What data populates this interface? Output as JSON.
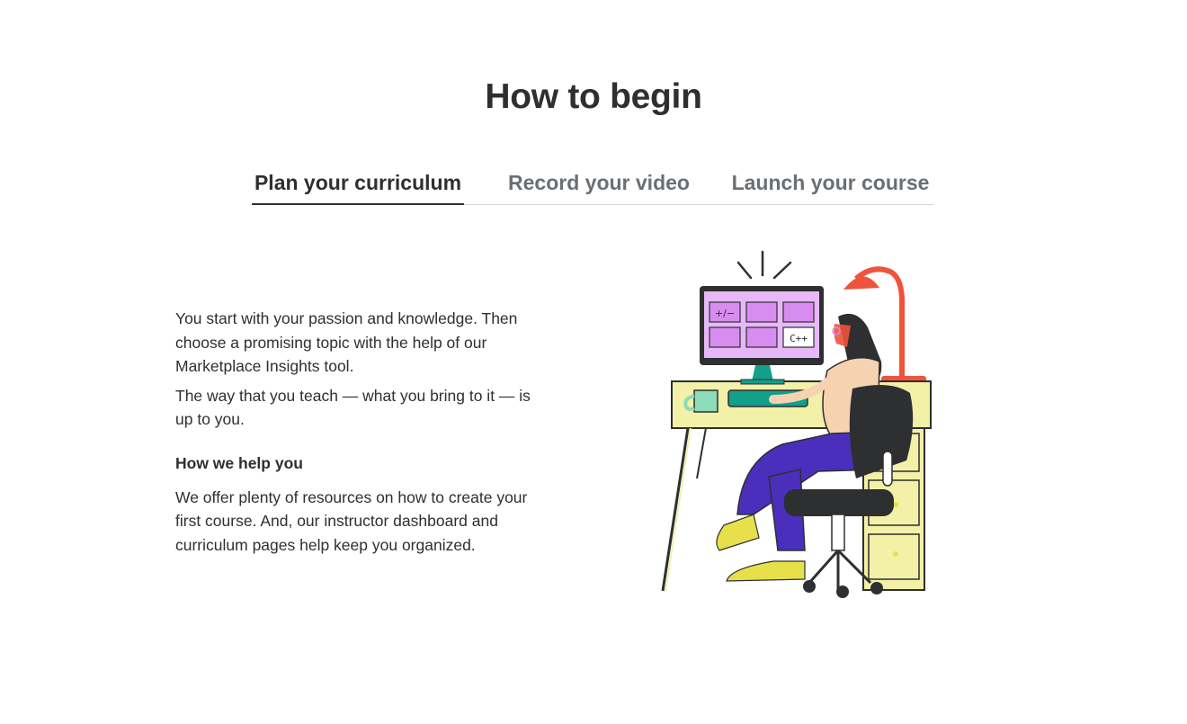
{
  "section": {
    "title": "How to begin"
  },
  "tabs": [
    {
      "label": "Plan your curriculum",
      "active": true
    },
    {
      "label": "Record your video",
      "active": false
    },
    {
      "label": "Launch your course",
      "active": false
    }
  ],
  "content": {
    "paragraphs": [
      "You start with your passion and knowledge. Then choose a promising topic with the help of our Marketplace Insights tool.",
      "The way that you teach — what you bring to it — is up to you."
    ],
    "subheading": "How we help you",
    "help_paragraph": "We offer plenty of resources on how to create your first course. And, our instructor dashboard and curriculum pages help keep you organized."
  },
  "illustration": {
    "icon": "woman-at-desk-illustration",
    "screen_tiles": [
      "+/−",
      "",
      "",
      "",
      "",
      "C++"
    ]
  },
  "colors": {
    "text": "#2d2f31",
    "muted_tab": "#6a6f73",
    "divider": "#d1d7dc",
    "lamp": "#f0533b",
    "desk": "#f3f0a8",
    "pants": "#4a2fbd",
    "shoes": "#e8e04a",
    "screen": "#d98cf0"
  }
}
